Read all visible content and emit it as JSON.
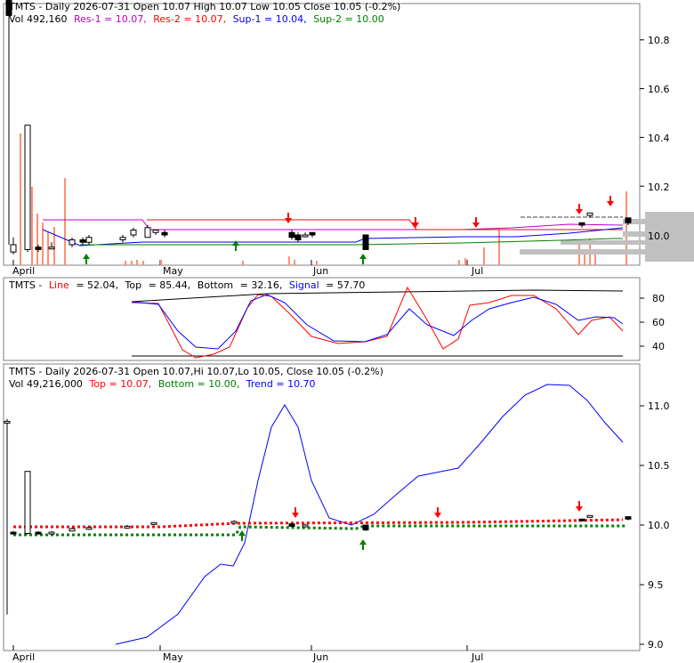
{
  "colors": {
    "up": "#008000",
    "down": "#ff0000",
    "blue": "#0000ff",
    "magenta": "#c000c0",
    "gray": "#c0c0c0",
    "salmon": "#ff9070",
    "black": "#000000"
  },
  "panel1": {
    "title_ticker": "TMTS - Daily 2026-07-31 Open 10.07  High 10.07  Low 10.05  Close 10.05 (-0.2%)",
    "vol": "Vol 492,160",
    "res1": "Res-1 = 10.07,",
    "res2": "Res-2 = 10.07,",
    "sup1": "Sup-1 = 10.04,",
    "sup2": "Sup-2 = 10.00",
    "yticks": [
      "10.8",
      "10.6",
      "10.4",
      "10.2",
      "10.0"
    ],
    "ytick_values": [
      10.8,
      10.6,
      10.4,
      10.2,
      10.0
    ]
  },
  "panel2": {
    "title_prefix": "TMTS -",
    "line_label": "Line",
    "line_value": "= 52.04,",
    "top_label": "Top",
    "top_value": "= 85.44,",
    "bottom_label": "Bottom",
    "bottom_value": "= 32.16,",
    "signal_label": "Signal",
    "signal_value": "= 57.70",
    "yticks": [
      "80",
      "60",
      "40"
    ]
  },
  "panel3": {
    "title": "TMTS - Daily 2026-07-31 Open 10.07,Hi 10.07,Lo 10.05, Close 10.05 (-0.2%)",
    "vol": "Vol 49,216,000",
    "top": "Top = 10.07,",
    "bottom": "Bottom = 10.00,",
    "trend": "Trend = 10.70",
    "yticks": [
      "11.0",
      "10.5",
      "10.0",
      "9.5",
      "9.0"
    ],
    "ytick_values": [
      11.0,
      10.5,
      10.0,
      9.5,
      9.0
    ]
  },
  "xaxis": {
    "months": [
      "April",
      "May",
      "Jun",
      "Jul"
    ]
  },
  "chart_data": [
    {
      "type": "candlestick",
      "title": "TMTS - Daily 2026-07-31 Open 10.07  High 10.07  Low 10.05  Close 10.05 (-0.2%)",
      "ylim": [
        9.87,
        10.97
      ],
      "legend": [
        "Res-1 = 10.07",
        "Res-2 = 10.07",
        "Sup-1 = 10.04",
        "Sup-2 = 10.00"
      ],
      "x_months": [
        "April",
        "May",
        "Jun",
        "Jul"
      ],
      "series": [
        {
          "name": "Res-2",
          "values": [
            10.06,
            10.06,
            10.06,
            10.06,
            10.07
          ]
        },
        {
          "name": "Sup-1",
          "values": [
            9.97,
            9.97,
            9.99,
            10.0,
            10.03
          ]
        },
        {
          "name": "Sup-2",
          "values": [
            9.96,
            9.97,
            9.97,
            9.98,
            10.0
          ]
        }
      ],
      "close": [
        9.93,
        10.45,
        9.94,
        9.98,
        10.0,
        10.02,
        10.01,
        10.0,
        9.97,
        10.06,
        10.05
      ]
    },
    {
      "type": "line",
      "title": "TMTS - Line = 52.04, Top = 85.44, Bottom = 32.16, Signal = 57.70",
      "ylim": [
        27,
        95
      ],
      "series": [
        {
          "name": "Line",
          "values": [
            75,
            70,
            36,
            40,
            82,
            78,
            55,
            45,
            46,
            88,
            38,
            70,
            81,
            76,
            52,
            66,
            52
          ]
        },
        {
          "name": "Signal",
          "values": [
            74,
            73,
            50,
            38,
            76,
            80,
            60,
            48,
            47,
            70,
            44,
            66,
            80,
            78,
            62,
            64,
            58
          ]
        }
      ],
      "top": 85.44,
      "bottom": 32.16
    },
    {
      "type": "line",
      "title": "TMTS - Daily 2026-07-31 Open 10.07,Hi 10.07,Lo 10.05, Close 10.05 (-0.2%)",
      "ylim": [
        8.95,
        11.2
      ],
      "legend": [
        "Top = 10.07",
        "Bottom = 10.00",
        "Trend = 10.70"
      ],
      "series": [
        {
          "name": "Trend",
          "values": [
            9.02,
            9.05,
            9.3,
            9.7,
            9.68,
            10.45,
            11.02,
            10.65,
            10.0,
            10.03,
            10.3,
            10.45,
            10.55,
            10.85,
            11.15,
            11.15,
            10.95,
            10.7
          ]
        },
        {
          "name": "Top",
          "values": [
            10.0,
            10.0,
            10.03,
            10.03,
            10.03,
            10.03,
            10.07
          ]
        },
        {
          "name": "Bottom",
          "values": [
            9.92,
            9.92,
            9.92,
            9.99,
            9.99,
            10.0,
            10.0
          ]
        }
      ]
    }
  ]
}
